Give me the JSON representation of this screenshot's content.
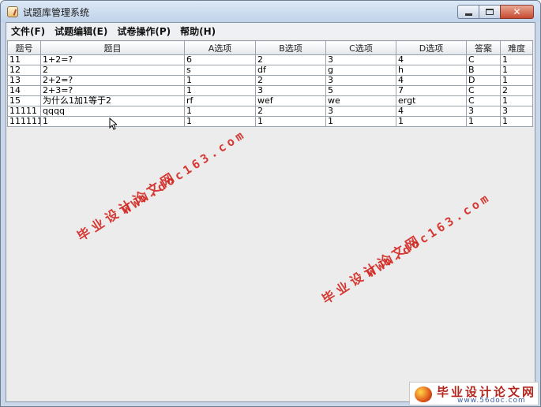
{
  "window": {
    "title": "试题库管理系统"
  },
  "menu": [
    "文件(F)",
    "试题编辑(E)",
    "试卷操作(P)",
    "帮助(H)"
  ],
  "table": {
    "headers": [
      "题号",
      "题目",
      "A选项",
      "B选项",
      "C选项",
      "D选项",
      "答案",
      "难度"
    ],
    "rows": [
      [
        "11",
        "1+2=?",
        "6",
        "2",
        "3",
        "4",
        "C",
        "1"
      ],
      [
        "12",
        "2",
        "s",
        "df",
        "g",
        "h",
        "B",
        "1"
      ],
      [
        "13",
        "2+2=?",
        "1",
        "2",
        "3",
        "4",
        "D",
        "1"
      ],
      [
        "14",
        "2+3=?",
        "1",
        "3",
        "5",
        "7",
        "C",
        "2"
      ],
      [
        "15",
        "为什么1加1等于2",
        "rf",
        "wef",
        "we",
        "ergt",
        "C",
        "1"
      ],
      [
        "11111",
        "qqqq",
        "1",
        "2",
        "3",
        "4",
        "3",
        "3"
      ],
      [
        "111111",
        "1",
        "1",
        "1",
        "1",
        "1",
        "1",
        "1"
      ]
    ]
  },
  "watermarks": {
    "site_cn": "毕业设计论文网",
    "site_url": "WWW.doc163.com"
  },
  "logo": {
    "cn": "毕业设计论文网",
    "url": "www.56doc.com"
  }
}
